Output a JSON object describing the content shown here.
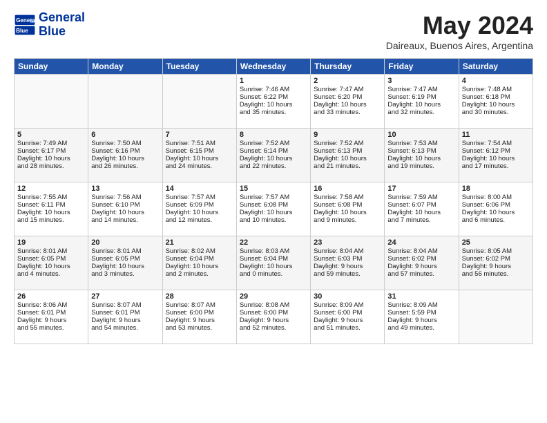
{
  "header": {
    "logo_line1": "General",
    "logo_line2": "Blue",
    "title": "May 2024",
    "location": "Daireaux, Buenos Aires, Argentina"
  },
  "days_of_week": [
    "Sunday",
    "Monday",
    "Tuesday",
    "Wednesday",
    "Thursday",
    "Friday",
    "Saturday"
  ],
  "weeks": [
    [
      {
        "day": "",
        "text": ""
      },
      {
        "day": "",
        "text": ""
      },
      {
        "day": "",
        "text": ""
      },
      {
        "day": "1",
        "text": "Sunrise: 7:46 AM\nSunset: 6:22 PM\nDaylight: 10 hours\nand 35 minutes."
      },
      {
        "day": "2",
        "text": "Sunrise: 7:47 AM\nSunset: 6:20 PM\nDaylight: 10 hours\nand 33 minutes."
      },
      {
        "day": "3",
        "text": "Sunrise: 7:47 AM\nSunset: 6:19 PM\nDaylight: 10 hours\nand 32 minutes."
      },
      {
        "day": "4",
        "text": "Sunrise: 7:48 AM\nSunset: 6:18 PM\nDaylight: 10 hours\nand 30 minutes."
      }
    ],
    [
      {
        "day": "5",
        "text": "Sunrise: 7:49 AM\nSunset: 6:17 PM\nDaylight: 10 hours\nand 28 minutes."
      },
      {
        "day": "6",
        "text": "Sunrise: 7:50 AM\nSunset: 6:16 PM\nDaylight: 10 hours\nand 26 minutes."
      },
      {
        "day": "7",
        "text": "Sunrise: 7:51 AM\nSunset: 6:15 PM\nDaylight: 10 hours\nand 24 minutes."
      },
      {
        "day": "8",
        "text": "Sunrise: 7:52 AM\nSunset: 6:14 PM\nDaylight: 10 hours\nand 22 minutes."
      },
      {
        "day": "9",
        "text": "Sunrise: 7:52 AM\nSunset: 6:13 PM\nDaylight: 10 hours\nand 21 minutes."
      },
      {
        "day": "10",
        "text": "Sunrise: 7:53 AM\nSunset: 6:13 PM\nDaylight: 10 hours\nand 19 minutes."
      },
      {
        "day": "11",
        "text": "Sunrise: 7:54 AM\nSunset: 6:12 PM\nDaylight: 10 hours\nand 17 minutes."
      }
    ],
    [
      {
        "day": "12",
        "text": "Sunrise: 7:55 AM\nSunset: 6:11 PM\nDaylight: 10 hours\nand 15 minutes."
      },
      {
        "day": "13",
        "text": "Sunrise: 7:56 AM\nSunset: 6:10 PM\nDaylight: 10 hours\nand 14 minutes."
      },
      {
        "day": "14",
        "text": "Sunrise: 7:57 AM\nSunset: 6:09 PM\nDaylight: 10 hours\nand 12 minutes."
      },
      {
        "day": "15",
        "text": "Sunrise: 7:57 AM\nSunset: 6:08 PM\nDaylight: 10 hours\nand 10 minutes."
      },
      {
        "day": "16",
        "text": "Sunrise: 7:58 AM\nSunset: 6:08 PM\nDaylight: 10 hours\nand 9 minutes."
      },
      {
        "day": "17",
        "text": "Sunrise: 7:59 AM\nSunset: 6:07 PM\nDaylight: 10 hours\nand 7 minutes."
      },
      {
        "day": "18",
        "text": "Sunrise: 8:00 AM\nSunset: 6:06 PM\nDaylight: 10 hours\nand 6 minutes."
      }
    ],
    [
      {
        "day": "19",
        "text": "Sunrise: 8:01 AM\nSunset: 6:05 PM\nDaylight: 10 hours\nand 4 minutes."
      },
      {
        "day": "20",
        "text": "Sunrise: 8:01 AM\nSunset: 6:05 PM\nDaylight: 10 hours\nand 3 minutes."
      },
      {
        "day": "21",
        "text": "Sunrise: 8:02 AM\nSunset: 6:04 PM\nDaylight: 10 hours\nand 2 minutes."
      },
      {
        "day": "22",
        "text": "Sunrise: 8:03 AM\nSunset: 6:04 PM\nDaylight: 10 hours\nand 0 minutes."
      },
      {
        "day": "23",
        "text": "Sunrise: 8:04 AM\nSunset: 6:03 PM\nDaylight: 9 hours\nand 59 minutes."
      },
      {
        "day": "24",
        "text": "Sunrise: 8:04 AM\nSunset: 6:02 PM\nDaylight: 9 hours\nand 57 minutes."
      },
      {
        "day": "25",
        "text": "Sunrise: 8:05 AM\nSunset: 6:02 PM\nDaylight: 9 hours\nand 56 minutes."
      }
    ],
    [
      {
        "day": "26",
        "text": "Sunrise: 8:06 AM\nSunset: 6:01 PM\nDaylight: 9 hours\nand 55 minutes."
      },
      {
        "day": "27",
        "text": "Sunrise: 8:07 AM\nSunset: 6:01 PM\nDaylight: 9 hours\nand 54 minutes."
      },
      {
        "day": "28",
        "text": "Sunrise: 8:07 AM\nSunset: 6:00 PM\nDaylight: 9 hours\nand 53 minutes."
      },
      {
        "day": "29",
        "text": "Sunrise: 8:08 AM\nSunset: 6:00 PM\nDaylight: 9 hours\nand 52 minutes."
      },
      {
        "day": "30",
        "text": "Sunrise: 8:09 AM\nSunset: 6:00 PM\nDaylight: 9 hours\nand 51 minutes."
      },
      {
        "day": "31",
        "text": "Sunrise: 8:09 AM\nSunset: 5:59 PM\nDaylight: 9 hours\nand 49 minutes."
      },
      {
        "day": "",
        "text": ""
      }
    ]
  ]
}
